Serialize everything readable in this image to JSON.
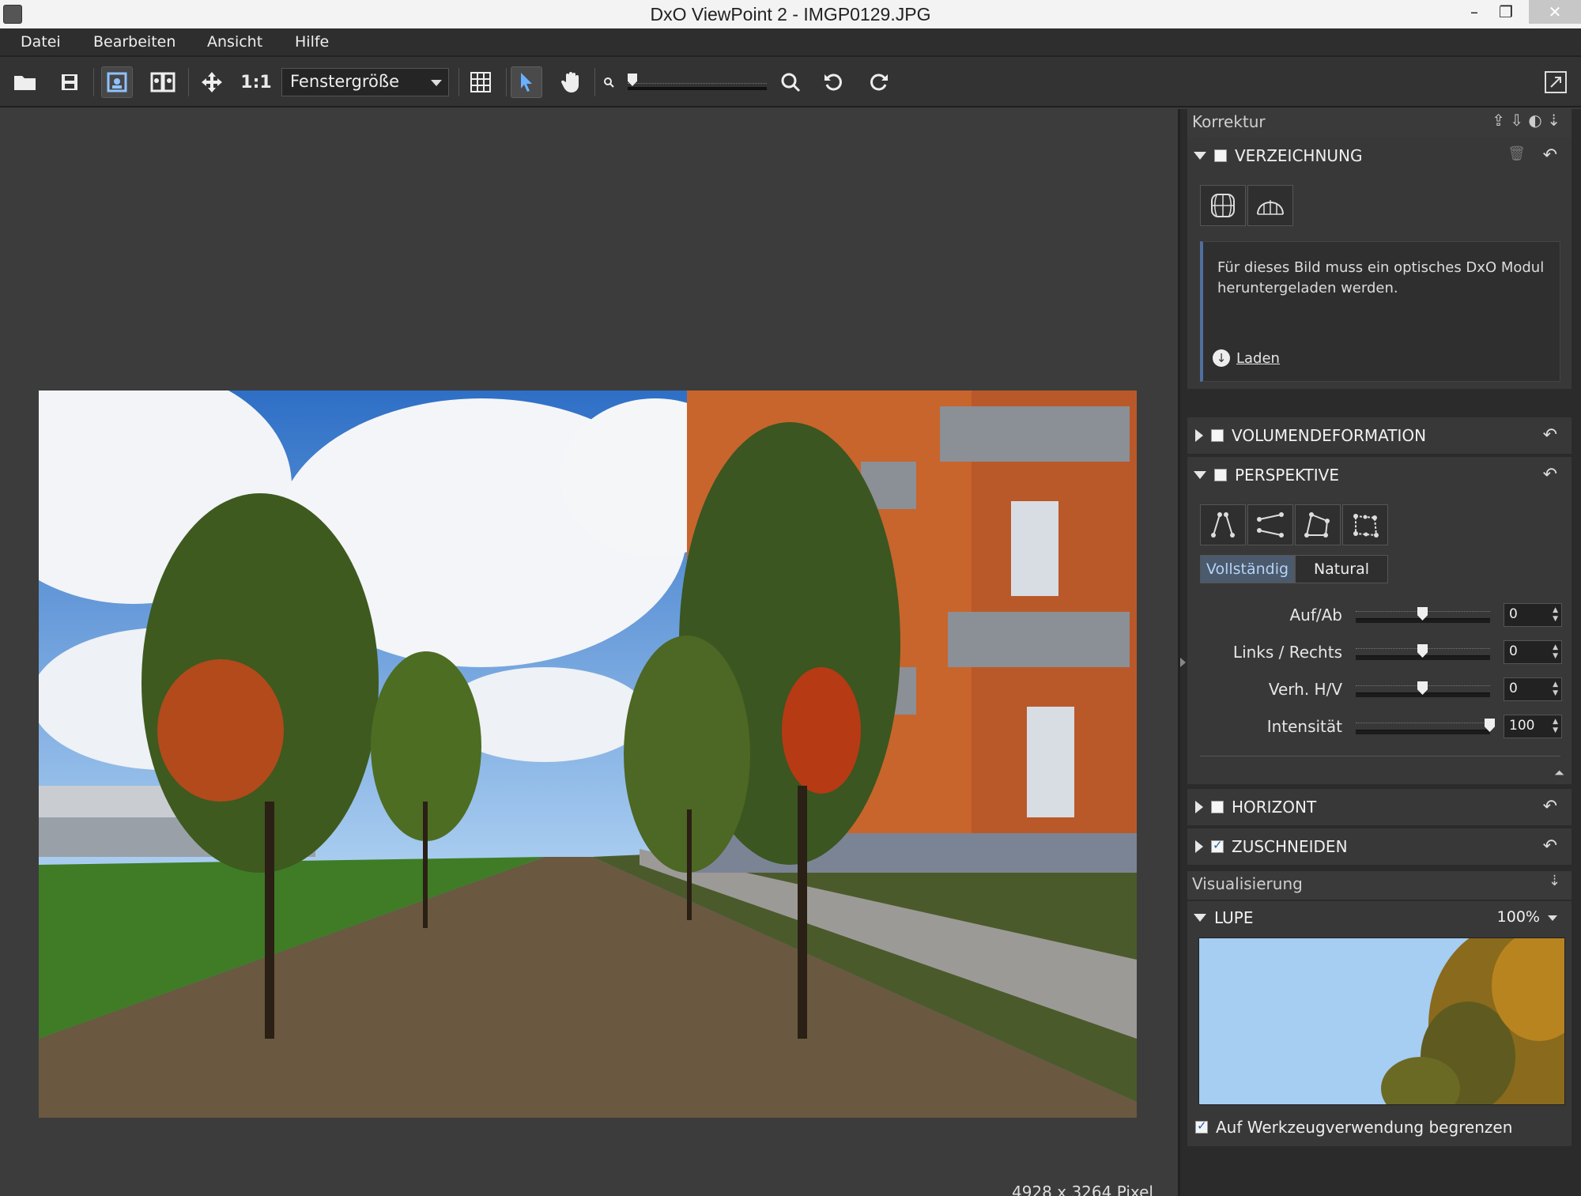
{
  "window": {
    "title": "DxO ViewPoint 2 - IMGP0129.JPG",
    "minimize": "–",
    "restore": "❐",
    "close": "✕"
  },
  "menu": [
    "Datei",
    "Bearbeiten",
    "Ansicht",
    "Hilfe"
  ],
  "toolbar": {
    "one_to_one": "1:1",
    "zoom_mode": "Fenstergröße"
  },
  "canvas": {
    "image_size": "4928 x 3264 Pixel"
  },
  "panel": {
    "korrektur_title": "Korrektur",
    "verzeichnung": {
      "title": "VERZEICHNUNG",
      "message": "Für dieses Bild muss ein optisches DxO Modul heruntergeladen werden.",
      "download_label": "Laden"
    },
    "volumendeformation": {
      "title": "VOLUMENDEFORMATION"
    },
    "perspektive": {
      "title": "PERSPEKTIVE",
      "mode_full": "Vollständig",
      "mode_natural": "Natural",
      "params": [
        {
          "label": "Auf/Ab",
          "value": "0",
          "level": 0.5
        },
        {
          "label": "Links / Rechts",
          "value": "0",
          "level": 0.5
        },
        {
          "label": "Verh. H/V",
          "value": "0",
          "level": 0.5
        },
        {
          "label": "Intensität",
          "value": "100",
          "level": 1.0
        }
      ]
    },
    "horizont": {
      "title": "HORIZONT"
    },
    "zuschneiden": {
      "title": "ZUSCHNEIDEN",
      "checked": true
    },
    "visualisierung_title": "Visualisierung",
    "lupe": {
      "title": "LUPE",
      "zoom": "100%",
      "limit_label": "Auf Werkzeugverwendung begrenzen"
    }
  },
  "colors": {
    "accent_blue": "#b6d3f5",
    "sky": "#4f8ad6",
    "facade": "#c8652c"
  }
}
